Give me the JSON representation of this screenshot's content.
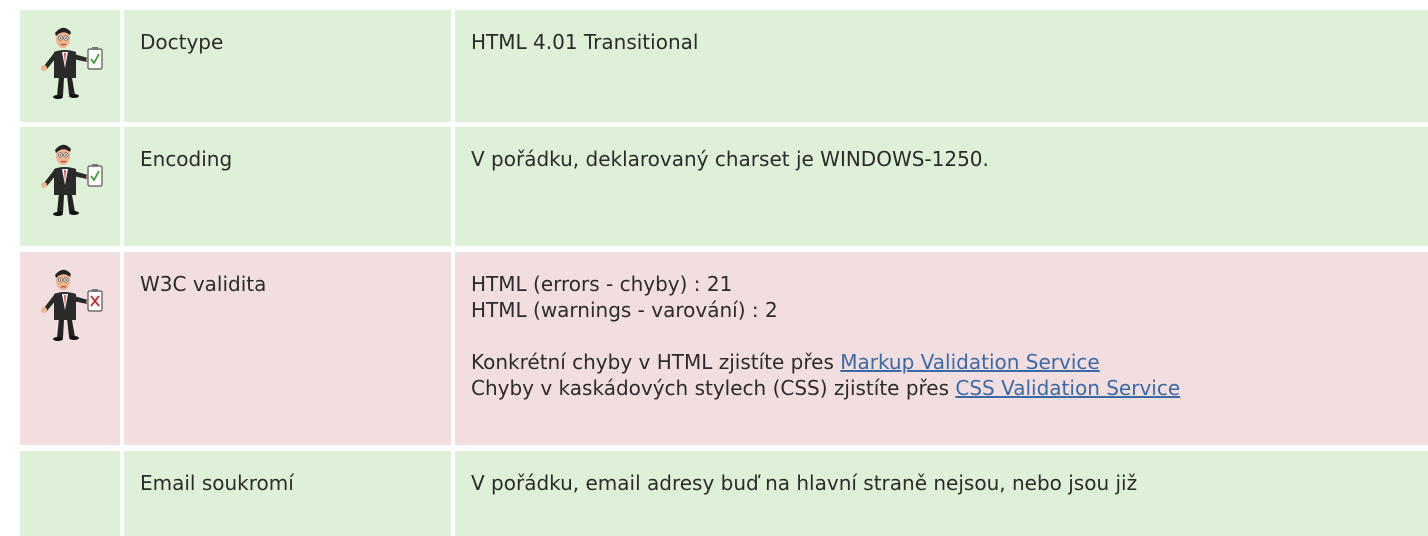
{
  "rows": [
    {
      "status": "ok",
      "icon": "man-checklist-ok-icon",
      "label": "Doctype",
      "value": "HTML 4.01 Transitional"
    },
    {
      "status": "ok",
      "icon": "man-checklist-ok-icon",
      "label": "Encoding",
      "value": "V pořádku, deklarovaný charset je WINDOWS-1250."
    },
    {
      "status": "error",
      "icon": "man-checklist-error-icon",
      "label": "W3C validita",
      "lines": [
        "HTML (errors - chyby) : 21",
        "HTML (warnings - varování) : 2"
      ],
      "markup_prefix": "Konkrétní chyby v HTML zjistíte přes ",
      "markup_link": "Markup Validation Service",
      "css_prefix": "Chyby v kaskádových stylech (CSS) zjistíte přes ",
      "css_link": "CSS Validation Service"
    },
    {
      "status": "ok",
      "label": "Email soukromí",
      "value": "V pořádku, email adresy buď na hlavní straně nejsou, nebo jsou již"
    }
  ],
  "colors": {
    "ok_background": "#dff0d8",
    "error_background": "#f2dede",
    "link": "#3a6aa8"
  }
}
